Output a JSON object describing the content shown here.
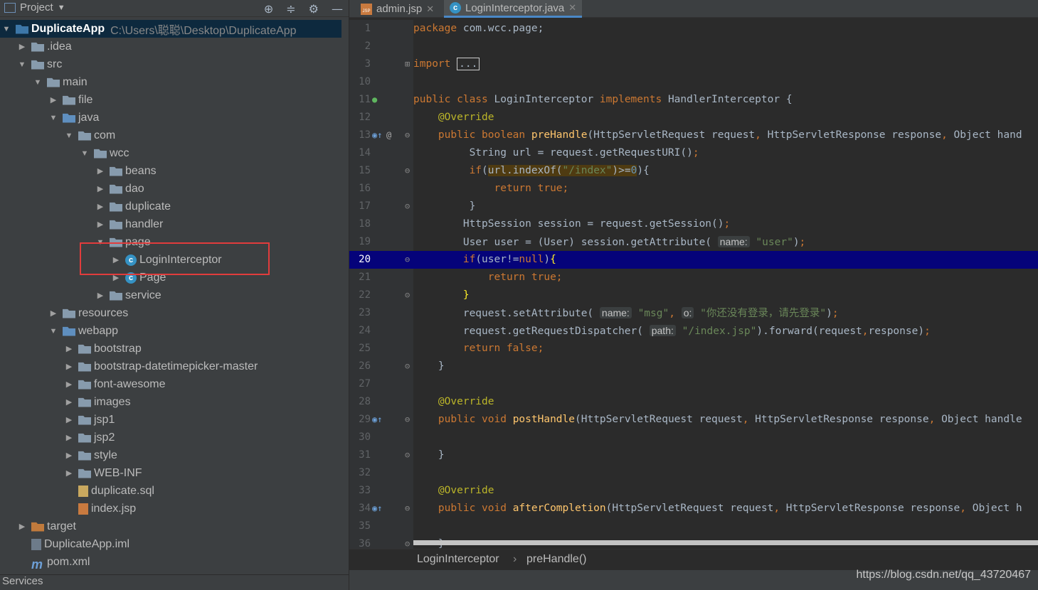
{
  "project_panel": {
    "title": "Project",
    "tools": [
      "⊕",
      "≑",
      "⚙",
      "—"
    ],
    "tree": [
      {
        "label": "DuplicateApp",
        "path": "C:\\Users\\聪聪\\Desktop\\DuplicateApp",
        "icon": "module-folder-icon",
        "arrow": "▼",
        "indent": 0
      },
      {
        "label": ".idea",
        "icon": "folder-icon",
        "arrow": "▶",
        "indent": 1
      },
      {
        "label": "src",
        "icon": "folder-icon",
        "arrow": "▼",
        "indent": 1
      },
      {
        "label": "main",
        "icon": "folder-icon",
        "arrow": "▼",
        "indent": 2
      },
      {
        "label": "file",
        "icon": "folder-icon",
        "arrow": "▶",
        "indent": 3
      },
      {
        "label": "java",
        "icon": "source-folder-icon",
        "arrow": "▼",
        "indent": 3
      },
      {
        "label": "com",
        "icon": "package-icon",
        "arrow": "▼",
        "indent": 4
      },
      {
        "label": "wcc",
        "icon": "package-icon",
        "arrow": "▼",
        "indent": 5
      },
      {
        "label": "beans",
        "icon": "package-icon",
        "arrow": "▶",
        "indent": 6
      },
      {
        "label": "dao",
        "icon": "package-icon",
        "arrow": "▶",
        "indent": 6
      },
      {
        "label": "duplicate",
        "icon": "package-icon",
        "arrow": "▶",
        "indent": 6
      },
      {
        "label": "handler",
        "icon": "package-icon",
        "arrow": "▶",
        "indent": 6
      },
      {
        "label": "page",
        "icon": "package-icon",
        "arrow": "▼",
        "indent": 6
      },
      {
        "label": "LoginInterceptor",
        "icon": "class-icon",
        "arrow": "▶",
        "indent": 7
      },
      {
        "label": "Page",
        "icon": "class-icon",
        "arrow": "▶",
        "indent": 7
      },
      {
        "label": "service",
        "icon": "package-icon",
        "arrow": "▶",
        "indent": 6
      },
      {
        "label": "resources",
        "icon": "resources-folder-icon",
        "arrow": "▶",
        "indent": 3
      },
      {
        "label": "webapp",
        "icon": "web-folder-icon",
        "arrow": "▼",
        "indent": 3
      },
      {
        "label": "bootstrap",
        "icon": "folder-icon",
        "arrow": "▶",
        "indent": 4
      },
      {
        "label": "bootstrap-datetimepicker-master",
        "icon": "folder-icon",
        "arrow": "▶",
        "indent": 4
      },
      {
        "label": "font-awesome",
        "icon": "folder-icon",
        "arrow": "▶",
        "indent": 4
      },
      {
        "label": "images",
        "icon": "folder-icon",
        "arrow": "▶",
        "indent": 4
      },
      {
        "label": "jsp1",
        "icon": "folder-icon",
        "arrow": "▶",
        "indent": 4
      },
      {
        "label": "jsp2",
        "icon": "folder-icon",
        "arrow": "▶",
        "indent": 4
      },
      {
        "label": "style",
        "icon": "folder-icon",
        "arrow": "▶",
        "indent": 4
      },
      {
        "label": "WEB-INF",
        "icon": "folder-icon",
        "arrow": "▶",
        "indent": 4
      },
      {
        "label": "duplicate.sql",
        "icon": "sql-file-icon",
        "arrow": "",
        "indent": 4
      },
      {
        "label": "index.jsp",
        "icon": "jsp-file-icon",
        "arrow": "",
        "indent": 4
      },
      {
        "label": "target",
        "icon": "excluded-folder-icon",
        "arrow": "▶",
        "indent": 1
      },
      {
        "label": "DuplicateApp.iml",
        "icon": "iml-file-icon",
        "arrow": "",
        "indent": 1
      },
      {
        "label": "pom.xml",
        "icon": "maven-icon",
        "arrow": "",
        "indent": 1
      }
    ],
    "services_label": "Services"
  },
  "editor": {
    "tabs": [
      {
        "label": "admin.jsp",
        "icon": "jsp-file-icon",
        "active": false
      },
      {
        "label": "LoginInterceptor.java",
        "icon": "class-icon",
        "active": true
      }
    ],
    "breadcrumb": [
      "LoginInterceptor",
      "preHandle()"
    ],
    "highlight_line": "20"
  },
  "watermark": "https://blog.csdn.net/qq_43720467",
  "colors": {
    "keyword": "#cc7832",
    "string": "#6a8759",
    "annotation": "#bbb529",
    "method": "#ffc66d",
    "highlight": "#05037a",
    "selection_box": "#e13c3c"
  }
}
